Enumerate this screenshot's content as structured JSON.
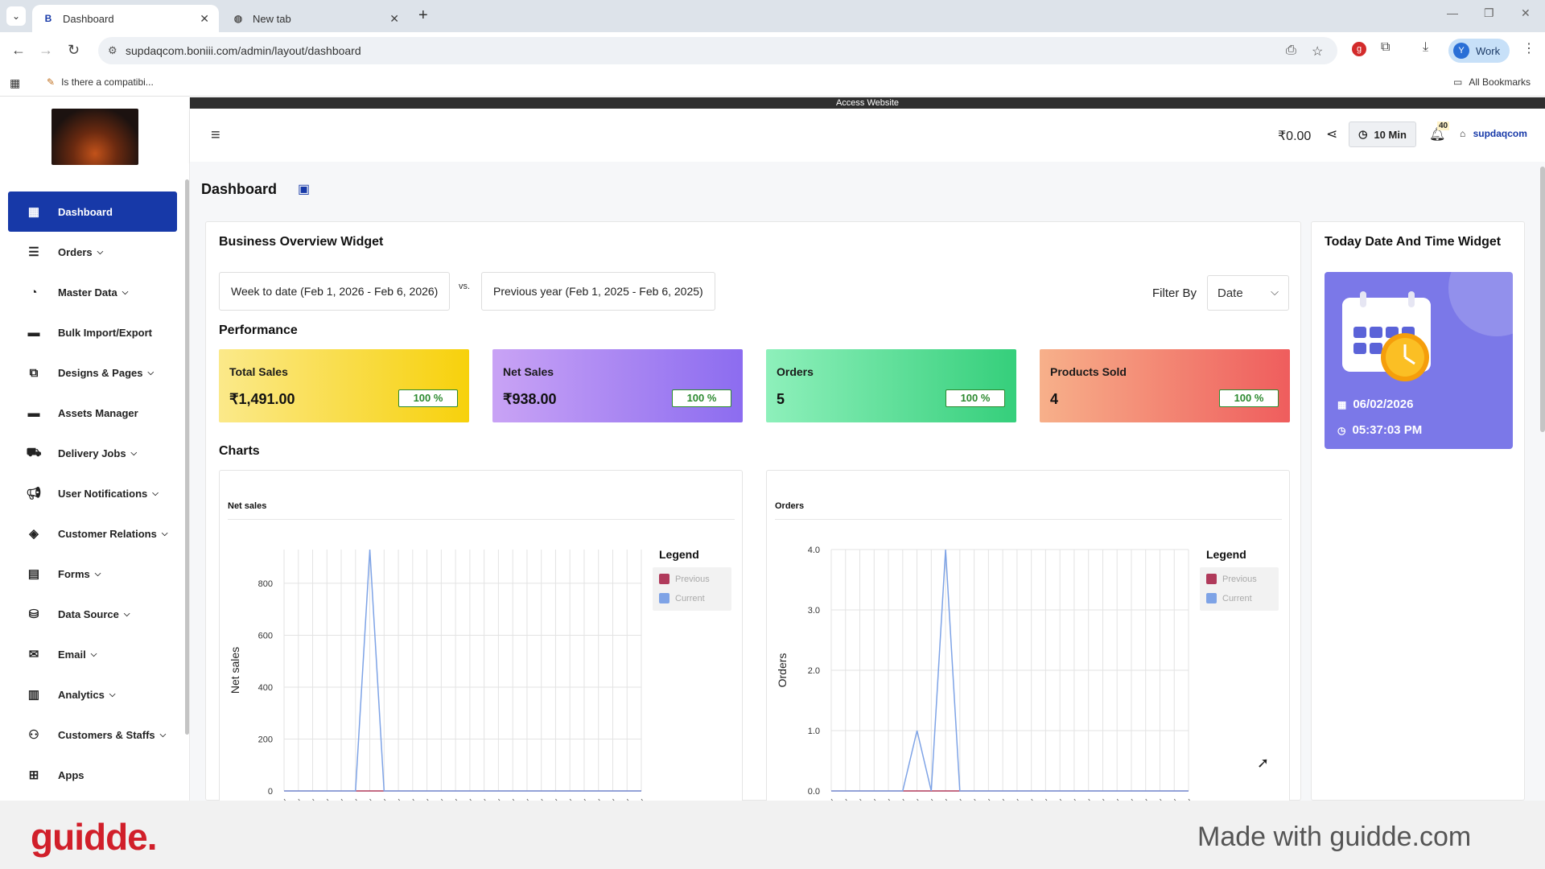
{
  "browser": {
    "tabs": [
      {
        "label": "Dashboard",
        "active": true
      },
      {
        "label": "New tab",
        "active": false
      }
    ],
    "url": "supdaqcom.boniii.com/admin/layout/dashboard",
    "bookmark_item": "Is there a compatibi...",
    "all_bookmarks": "All Bookmarks",
    "profile_initial": "Y",
    "profile_label": "Work"
  },
  "app": {
    "access_bar": "Access Website",
    "header": {
      "balance": "₹0.00",
      "timer": "10 Min",
      "notif_count": "40",
      "store_name": "supdaqcom"
    },
    "sidebar": {
      "items": [
        {
          "label": "Dashboard",
          "icon": "dashboard-icon",
          "has_chevron": false,
          "active": true
        },
        {
          "label": "Orders",
          "icon": "orders-icon",
          "has_chevron": true
        },
        {
          "label": "Master Data",
          "icon": "master-data-icon",
          "has_chevron": true
        },
        {
          "label": "Bulk Import/Export",
          "icon": "folder-icon",
          "has_chevron": false
        },
        {
          "label": "Designs & Pages",
          "icon": "designs-icon",
          "has_chevron": true
        },
        {
          "label": "Assets Manager",
          "icon": "folder-icon",
          "has_chevron": false
        },
        {
          "label": "Delivery Jobs",
          "icon": "delivery-icon",
          "has_chevron": true
        },
        {
          "label": "User Notifications",
          "icon": "megaphone-icon",
          "has_chevron": true
        },
        {
          "label": "Customer Relations",
          "icon": "handshake-icon",
          "has_chevron": true
        },
        {
          "label": "Forms",
          "icon": "forms-icon",
          "has_chevron": true
        },
        {
          "label": "Data Source",
          "icon": "database-icon",
          "has_chevron": true
        },
        {
          "label": "Email",
          "icon": "email-icon",
          "has_chevron": true
        },
        {
          "label": "Analytics",
          "icon": "analytics-icon",
          "has_chevron": true
        },
        {
          "label": "Customers & Staffs",
          "icon": "customers-icon",
          "has_chevron": true
        },
        {
          "label": "Apps",
          "icon": "apps-icon",
          "has_chevron": false
        }
      ]
    },
    "page_title": "Dashboard",
    "overview": {
      "title": "Business Overview Widget",
      "range_current": "Week to date (Feb 1, 2026 - Feb 6, 2026)",
      "vs_label": "vs.",
      "range_previous": "Previous year (Feb 1, 2025 - Feb 6, 2025)",
      "filter_label": "Filter By",
      "filter_value": "Date",
      "performance_label": "Performance",
      "stats": [
        {
          "label": "Total Sales",
          "value": "₹1,491.00",
          "pct": "100 %"
        },
        {
          "label": "Net Sales",
          "value": "₹938.00",
          "pct": "100 %"
        },
        {
          "label": "Orders",
          "value": "5",
          "pct": "100 %"
        },
        {
          "label": "Products Sold",
          "value": "4",
          "pct": "100 %"
        }
      ],
      "charts_label": "Charts"
    },
    "datetime_widget": {
      "title": "Today Date And Time Widget",
      "date": "06/02/2026",
      "time": "05:37:03 PM"
    }
  },
  "chart_data": [
    {
      "type": "line",
      "title": "Net sales",
      "xlabel": "",
      "ylabel": "Net sales",
      "ylim": [
        0,
        930
      ],
      "yticks": [
        0,
        200,
        400,
        600,
        800
      ],
      "legend_title": "Legend",
      "legend_position": "right",
      "grid": true,
      "series": [
        {
          "name": "Previous",
          "color": "#b03a5b",
          "values": [
            0,
            0,
            0,
            0,
            0,
            0,
            0,
            0,
            0,
            0,
            0,
            0,
            0,
            0,
            0,
            0,
            0,
            0,
            0,
            0,
            0,
            0,
            0,
            0,
            0,
            0
          ]
        },
        {
          "name": "Current",
          "color": "#7ea3e6",
          "values": [
            0,
            0,
            0,
            0,
            0,
            0,
            930,
            0,
            0,
            0,
            0,
            0,
            0,
            0,
            0,
            0,
            0,
            0,
            0,
            0,
            0,
            0,
            0,
            0,
            0,
            0
          ]
        }
      ]
    },
    {
      "type": "line",
      "title": "Orders",
      "xlabel": "",
      "ylabel": "Orders",
      "ylim": [
        0,
        4
      ],
      "yticks": [
        "0.0",
        "1.0",
        "2.0",
        "3.0",
        "4.0"
      ],
      "legend_title": "Legend",
      "legend_position": "right",
      "grid": true,
      "series": [
        {
          "name": "Previous",
          "color": "#b03a5b",
          "values": [
            0,
            0,
            0,
            0,
            0,
            0,
            0,
            0,
            0,
            0,
            0,
            0,
            0,
            0,
            0,
            0,
            0,
            0,
            0,
            0,
            0,
            0,
            0,
            0,
            0,
            0
          ]
        },
        {
          "name": "Current",
          "color": "#7ea3e6",
          "values": [
            0,
            0,
            0,
            0,
            0,
            0,
            1,
            0,
            4,
            0,
            0,
            0,
            0,
            0,
            0,
            0,
            0,
            0,
            0,
            0,
            0,
            0,
            0,
            0,
            0,
            0
          ]
        }
      ]
    }
  ],
  "footer": {
    "logo": "guidde.",
    "made_with": "Made with guidde.com"
  }
}
